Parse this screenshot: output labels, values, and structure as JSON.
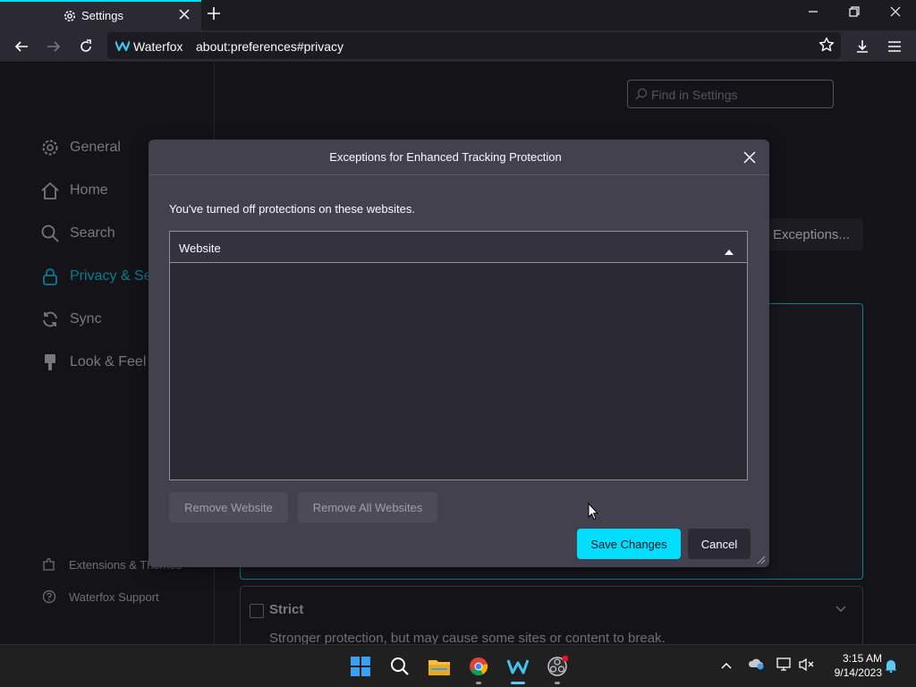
{
  "browser": {
    "tab_title": "Settings",
    "brand": "Waterfox",
    "url": "about:preferences#privacy"
  },
  "sidebar": {
    "items": [
      {
        "label": "General",
        "icon": "gear-icon"
      },
      {
        "label": "Home",
        "icon": "home-icon"
      },
      {
        "label": "Search",
        "icon": "search-icon"
      },
      {
        "label": "Privacy & Se",
        "icon": "lock-icon"
      },
      {
        "label": "Sync",
        "icon": "sync-icon"
      },
      {
        "label": "Look & Feel",
        "icon": "brush-icon"
      }
    ],
    "bottom": [
      {
        "label": "Extensions & Themes",
        "icon": "puzzle-icon"
      },
      {
        "label": "Waterfox Support",
        "icon": "help-icon"
      }
    ]
  },
  "settings": {
    "find_placeholder": "Find in Settings",
    "exceptions_button": "Exceptions...",
    "strict_title": "Strict",
    "strict_desc": "Stronger protection, but may cause some sites or content to break."
  },
  "dialog": {
    "title": "Exceptions for Enhanced Tracking Protection",
    "intro": "You've turned off protections on these websites.",
    "column_header": "Website",
    "remove_website": "Remove Website",
    "remove_all": "Remove All Websites",
    "save": "Save Changes",
    "cancel": "Cancel"
  },
  "taskbar": {
    "time": "3:15 AM",
    "date": "9/14/2023"
  },
  "colors": {
    "accent": "#00ddff",
    "page_bg": "#1c1b22",
    "dialog_bg": "#42414d"
  }
}
